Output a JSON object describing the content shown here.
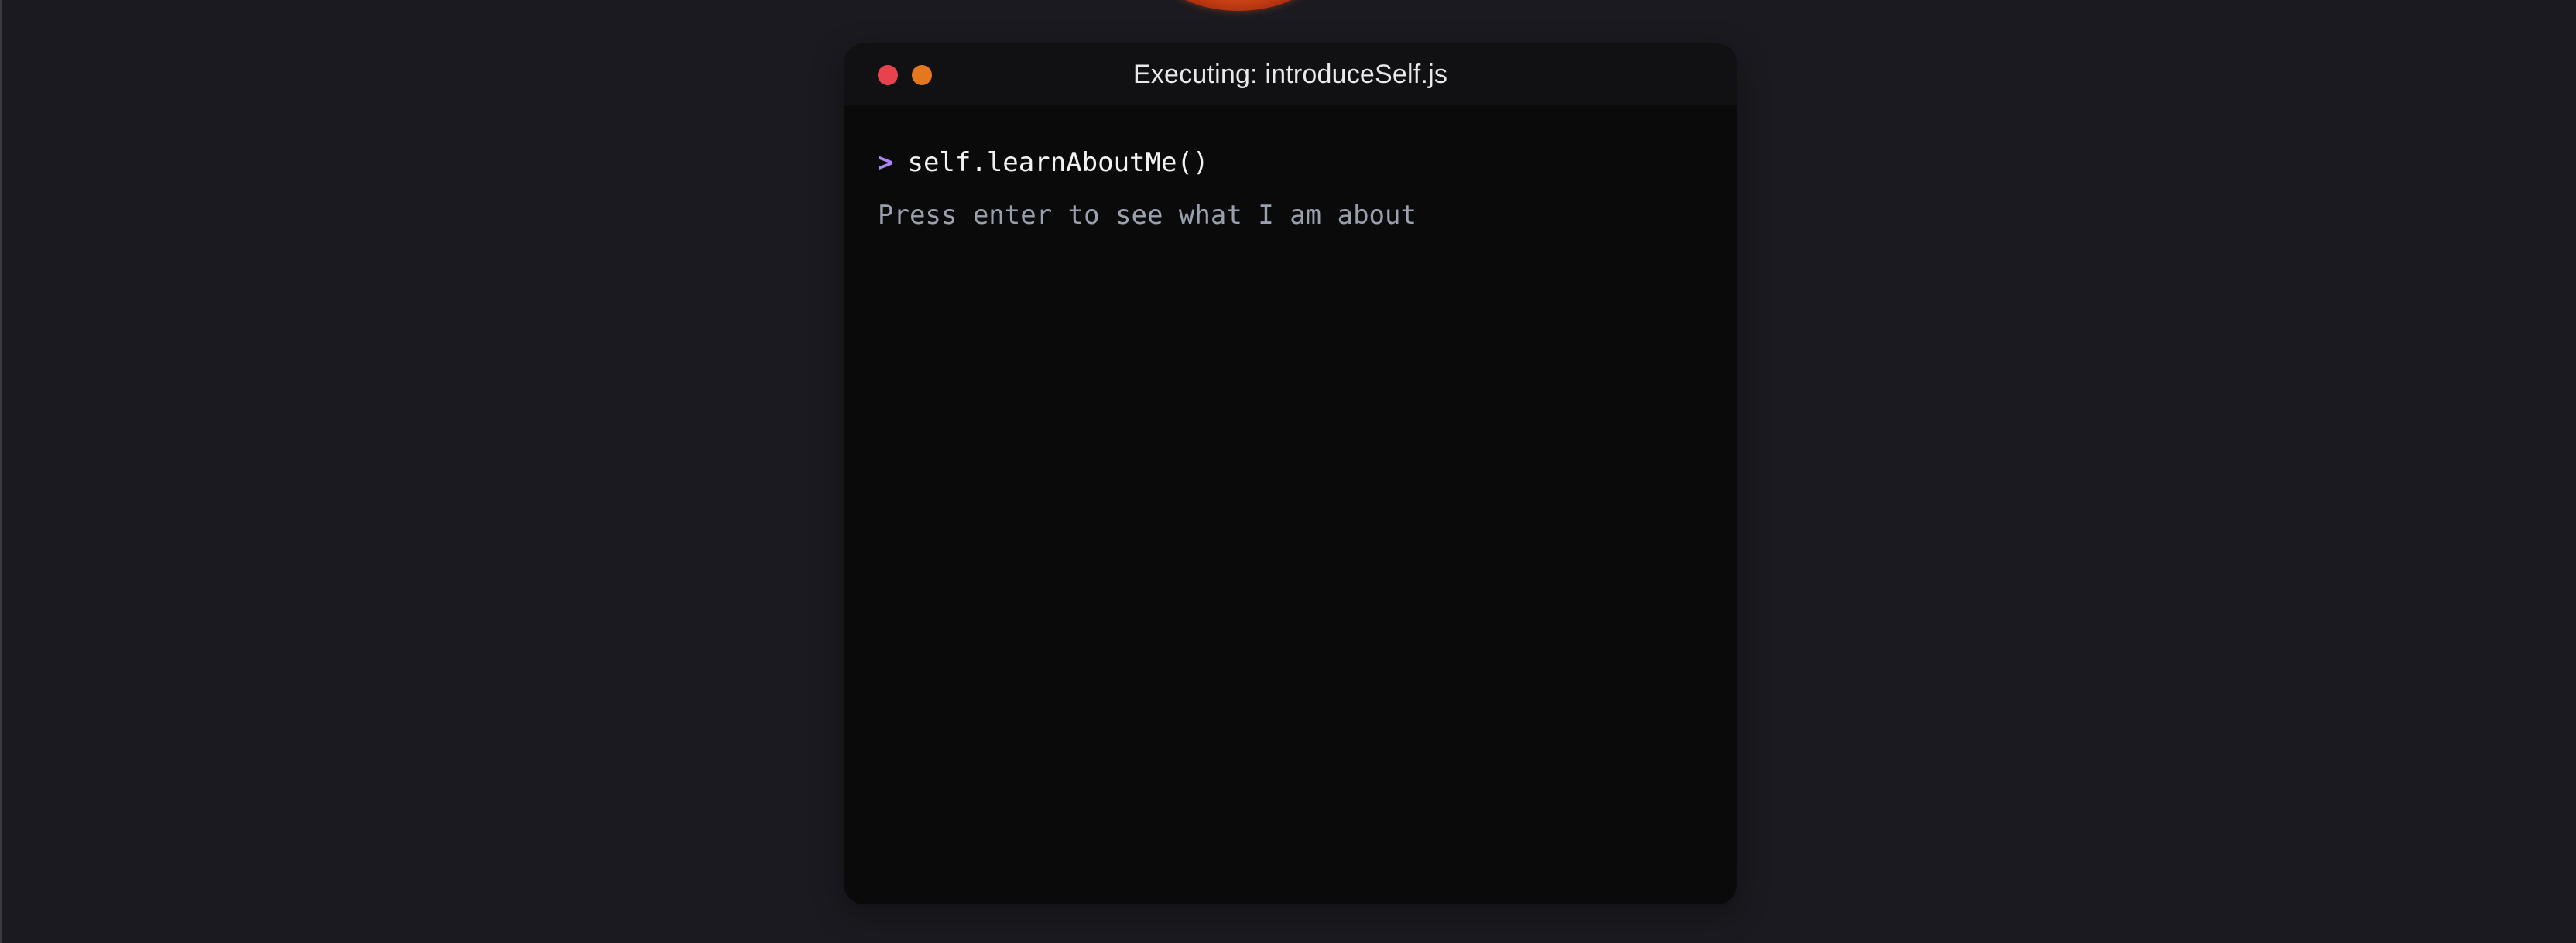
{
  "terminal": {
    "title": "Executing: introduceSelf.js",
    "prompt_symbol": ">",
    "command": "self.learnAboutMe()",
    "hint": "Press enter to see what I am about"
  },
  "colors": {
    "page_background": "#1b1a20",
    "terminal_background": "#0a0a0a",
    "titlebar_background": "#111114",
    "close_dot": "#e8424f",
    "minimize_dot": "#e5781f",
    "prompt": "#b083f5",
    "hint_text": "#9aa0ae"
  },
  "icons": {
    "close": "close-dot-icon",
    "minimize": "minimize-dot-icon",
    "planet": "planet-image"
  }
}
